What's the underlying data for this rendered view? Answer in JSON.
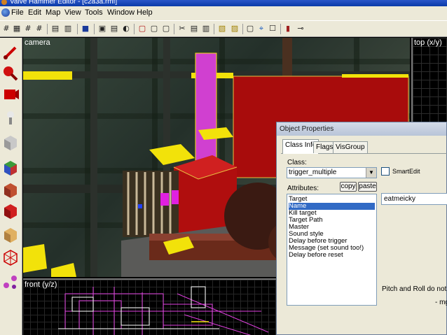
{
  "window": {
    "title": "Valve Hammer Editor - [c2a3a.rmf]"
  },
  "menu": [
    "File",
    "Edit",
    "Map",
    "View",
    "Tools",
    "Window",
    "Help"
  ],
  "toolbar_glyphs": [
    "#",
    "▦",
    "#",
    "#",
    "▤",
    "▥",
    "■",
    "▣",
    "▤",
    "◐",
    "▢",
    "▢",
    "▢",
    "✂",
    "▤",
    "▥",
    "▧",
    "▨",
    "▢",
    "⌖",
    "☐",
    "▮",
    "⊸"
  ],
  "views": {
    "camera": "camera",
    "top": "top (x/y)",
    "front": "front (y/z)"
  },
  "palette_tools": [
    "selection-tool-icon",
    "magnify-tool-icon",
    "camera-tool-icon",
    "entity-tool-icon",
    "block-tool-icon",
    "texture-tool-icon",
    "apply-texture-icon",
    "decal-tool-icon",
    "clipping-tool-icon",
    "vertex-tool-icon",
    "path-tool-icon"
  ],
  "dialog": {
    "title": "Object Properties",
    "tabs": [
      "Class Info",
      "Flags",
      "VisGroup"
    ],
    "class_label": "Class:",
    "class_value": "trigger_multiple",
    "smartedit_label": "SmartEdit",
    "attributes_label": "Attributes:",
    "copy_label": "copy",
    "paste_label": "paste",
    "attributes": [
      "Target",
      "Name",
      "Kill target",
      "Target Path",
      "Master",
      "Sound style",
      "Delay before trigger",
      "Message (set sound too!)",
      "Delay before reset"
    ],
    "selected_attribute": "Name",
    "value": "eatmeicky",
    "help_text": "Pitch and Roll do not work",
    "help_text2": "- mgr"
  },
  "colors": {
    "selection": "#316ac5",
    "trigger_yellow": "#f2e20a",
    "brick_red": "#b01010",
    "pillar_magenta": "#e040e0"
  }
}
